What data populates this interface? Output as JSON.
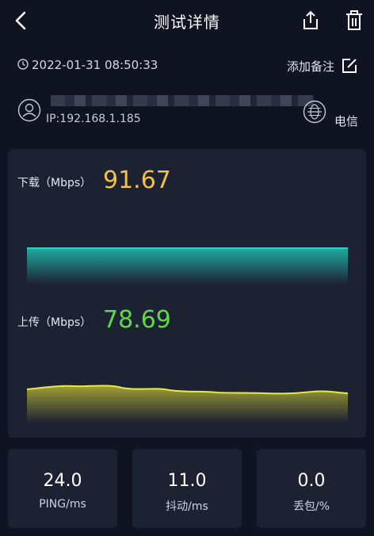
{
  "header": {
    "title": "测试详情",
    "icons": [
      "back-arrow-icon",
      "share-icon",
      "trash-icon"
    ]
  },
  "meta": {
    "datetime": "2022-01-31 08:50:33",
    "add_note_label": "添加备注"
  },
  "user": {
    "ip": "IP:192.168.1.185",
    "carrier": "电信"
  },
  "download": {
    "label": "下载（Mbps）",
    "value": "91.67",
    "color": "#f2c14a",
    "graph_color": "#2ad3c4"
  },
  "upload": {
    "label": "上传（Mbps）",
    "value": "78.69",
    "color": "#5fd94a",
    "graph_color": "#e8e84a"
  },
  "stats": [
    {
      "value": "24.0",
      "label": "PING/ms"
    },
    {
      "value": "11.0",
      "label": "抖动/ms"
    },
    {
      "value": "0.0",
      "label": "丢包/%"
    }
  ]
}
